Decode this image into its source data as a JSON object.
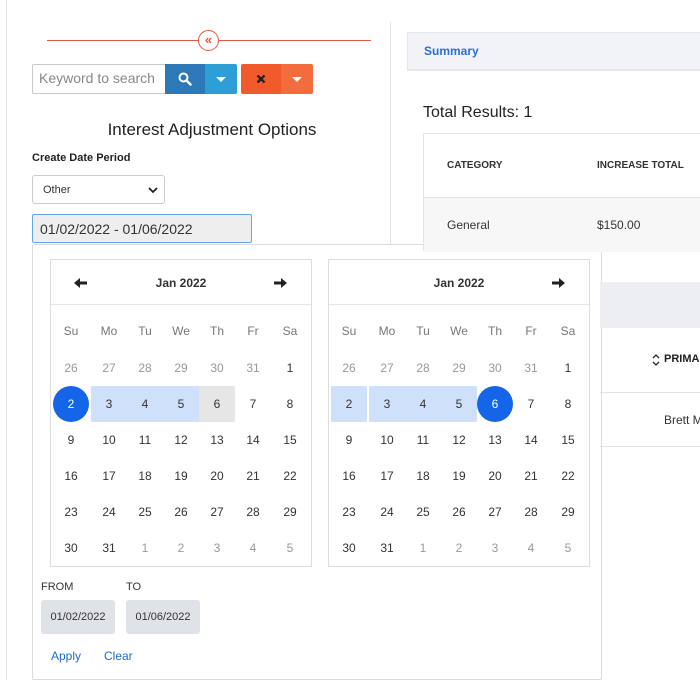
{
  "filter": {
    "search_placeholder": "Keyword to search",
    "section_title": "Interest Adjustment Options",
    "create_date_label": "Create Date Period",
    "period_selected": "Other",
    "date_range_value": "01/02/2022 - 01/06/2022"
  },
  "datepicker": {
    "weekdays": [
      "Su",
      "Mo",
      "Tu",
      "We",
      "Th",
      "Fr",
      "Sa"
    ],
    "left_month": "Jan 2022",
    "right_month": "Jan 2022",
    "left_days": [
      [
        "26",
        "27",
        "28",
        "29",
        "30",
        "31",
        "1"
      ],
      [
        "2",
        "3",
        "4",
        "5",
        "6",
        "7",
        "8"
      ],
      [
        "9",
        "10",
        "11",
        "12",
        "13",
        "14",
        "15"
      ],
      [
        "16",
        "17",
        "18",
        "19",
        "20",
        "21",
        "22"
      ],
      [
        "23",
        "24",
        "25",
        "26",
        "27",
        "28",
        "29"
      ],
      [
        "30",
        "31",
        "1",
        "2",
        "3",
        "4",
        "5"
      ]
    ],
    "right_days": [
      [
        "26",
        "27",
        "28",
        "29",
        "30",
        "31",
        "1"
      ],
      [
        "2",
        "3",
        "4",
        "5",
        "6",
        "7",
        "8"
      ],
      [
        "9",
        "10",
        "11",
        "12",
        "13",
        "14",
        "15"
      ],
      [
        "16",
        "17",
        "18",
        "19",
        "20",
        "21",
        "22"
      ],
      [
        "23",
        "24",
        "25",
        "26",
        "27",
        "28",
        "29"
      ],
      [
        "30",
        "31",
        "1",
        "2",
        "3",
        "4",
        "5"
      ]
    ],
    "from_label": "FROM",
    "to_label": "TO",
    "from_value": "01/02/2022",
    "to_value": "01/06/2022",
    "apply_label": "Apply",
    "clear_label": "Clear"
  },
  "summary": {
    "tab_label": "Summary",
    "total_results": "Total Results: 1",
    "columns": [
      "CATEGORY",
      "INCREASE TOTAL"
    ],
    "rows": [
      [
        "General",
        "$150.00"
      ]
    ],
    "primary_header": "PRIMA",
    "primary_value": "Brett M"
  },
  "colors": {
    "accent_blue": "#1565e8",
    "range_fill": "#cfe0fb",
    "search_button": "#2d79b8",
    "clear_button": "#f15a2b",
    "collapse_line": "#e15a47"
  }
}
